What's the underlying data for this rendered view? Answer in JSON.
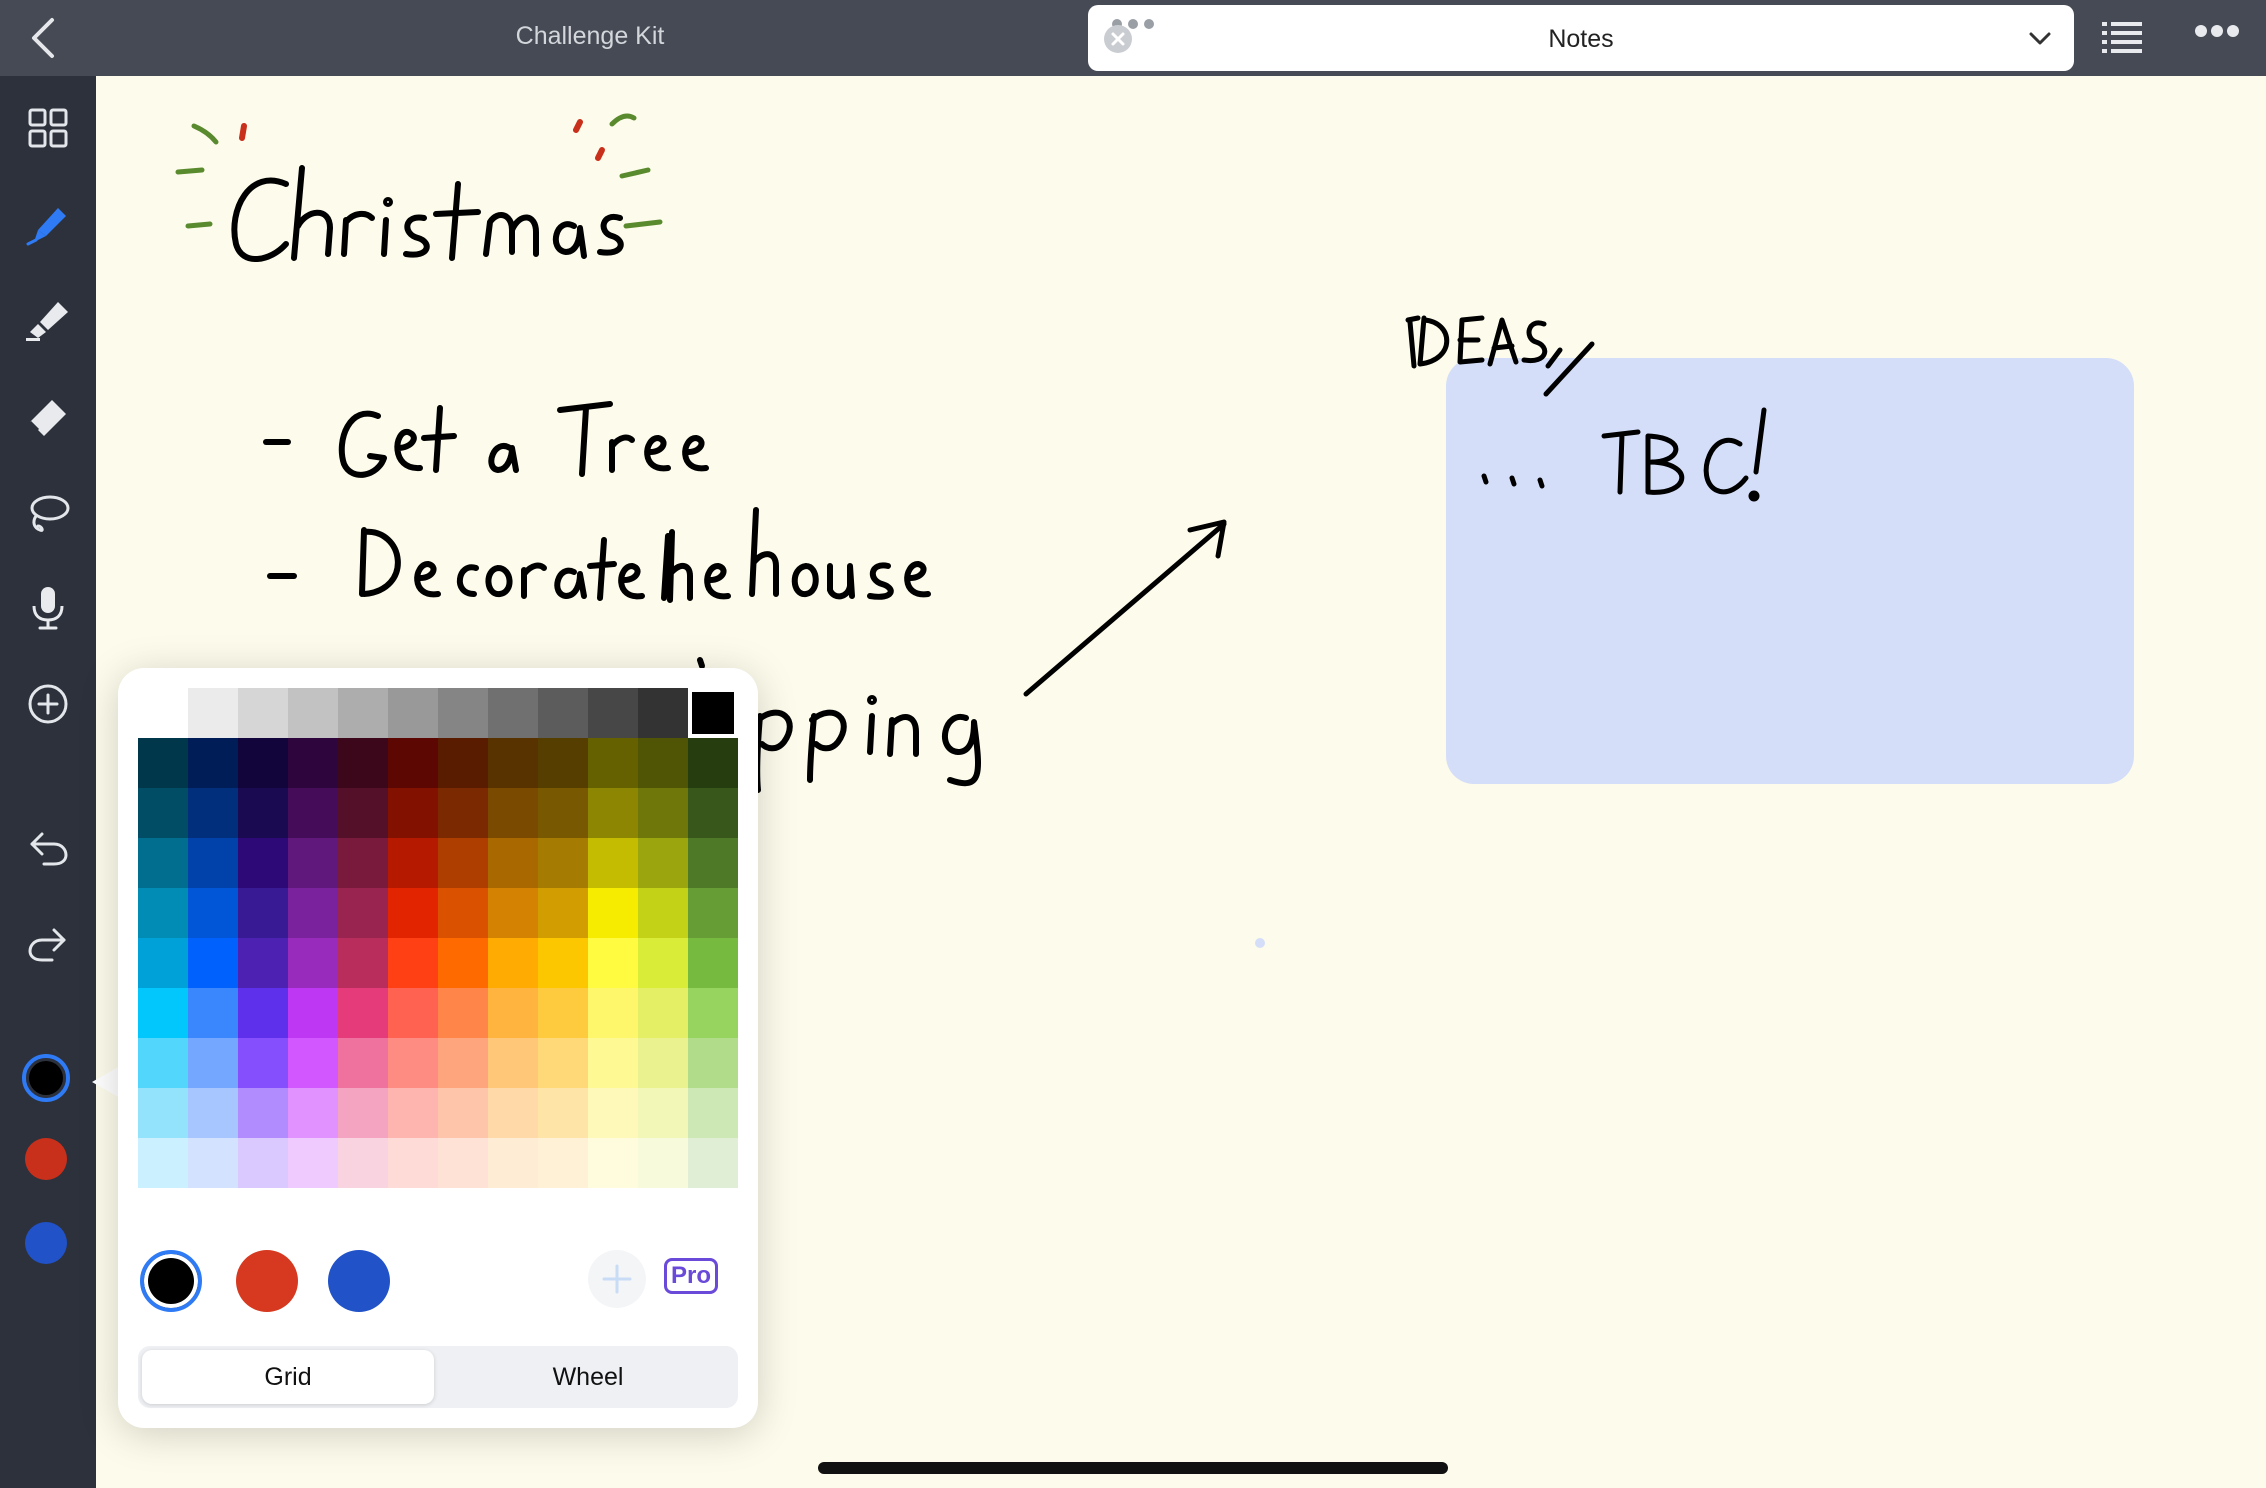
{
  "topbar": {
    "doc_title": "Challenge Kit",
    "notes_label": "Notes",
    "icons": [
      "back-icon",
      "close-icon",
      "chevron-down-icon",
      "list-icon",
      "more-icon"
    ]
  },
  "sidebar": {
    "tools": [
      "grid-icon",
      "pen-icon",
      "highlighter-icon",
      "eraser-icon",
      "lasso-icon",
      "microphone-icon",
      "add-icon",
      "undo-icon",
      "redo-icon"
    ],
    "selected_tool": "pen-icon",
    "swatches": [
      {
        "name": "black",
        "color": "#000000",
        "selected": true
      },
      {
        "name": "red",
        "color": "#c9301c"
      },
      {
        "name": "blue",
        "color": "#2152c8"
      }
    ]
  },
  "canvas": {
    "heading": "Christmas",
    "list": [
      "Get a Tree",
      "Decorate the house",
      "Shopping"
    ],
    "ideas_box": {
      "title": "IDEAS",
      "body": "... TBC!",
      "color": "#d4def8"
    }
  },
  "color_picker": {
    "gray_row": [
      "#ffffff",
      "#ebebeb",
      "#d6d6d6",
      "#c2c2c2",
      "#adadad",
      "#999999",
      "#858585",
      "#707070",
      "#5c5c5c",
      "#474747",
      "#333333",
      "#000000"
    ],
    "selected_color": "#000000",
    "columns": [
      [
        "#00374a",
        "#004d65",
        "#016e8f",
        "#008cb4",
        "#00a1d8",
        "#01c7fc",
        "#52d6fc",
        "#93e3fd",
        "#cbf0ff"
      ],
      [
        "#011d57",
        "#012f7b",
        "#0042a9",
        "#0056d6",
        "#0061fd",
        "#3a87fd",
        "#74a7ff",
        "#a7c6ff",
        "#d3e2ff"
      ],
      [
        "#11053b",
        "#1a0a52",
        "#2c0977",
        "#371a94",
        "#4d22b2",
        "#5e30eb",
        "#864ffe",
        "#b18cfe",
        "#d9c9fe"
      ],
      [
        "#2e063d",
        "#450d59",
        "#61187c",
        "#7a219e",
        "#982abc",
        "#be38f3",
        "#d357fe",
        "#e292fe",
        "#efcaff"
      ],
      [
        "#3c071b",
        "#551029",
        "#791a3d",
        "#99244f",
        "#b92d5d",
        "#e63b7a",
        "#ee719e",
        "#f4a4c0",
        "#f9d3e0"
      ],
      [
        "#5c0701",
        "#831100",
        "#b51a00",
        "#e22400",
        "#ff4015",
        "#ff6250",
        "#ff8c82",
        "#ffb5af",
        "#ffdbd8"
      ],
      [
        "#5a1c00",
        "#7b2900",
        "#ad3e00",
        "#da5100",
        "#ff6a00",
        "#ff8648",
        "#ffa57d",
        "#ffc5ab",
        "#ffe2d6"
      ],
      [
        "#583300",
        "#7a4a00",
        "#a96800",
        "#d38301",
        "#ffab01",
        "#feb43f",
        "#ffc777",
        "#ffd9a8",
        "#ffecd4"
      ],
      [
        "#563d00",
        "#785800",
        "#a67b01",
        "#d19d01",
        "#fdc700",
        "#fecb3e",
        "#ffd977",
        "#ffe4a8",
        "#fff1d5"
      ],
      [
        "#666100",
        "#8d8602",
        "#c4bc00",
        "#f5ec00",
        "#fffb41",
        "#fff76b",
        "#fff994",
        "#fff9b9",
        "#fffcdd"
      ],
      [
        "#4f5504",
        "#6f760a",
        "#9ba50e",
        "#c3d117",
        "#d9ec37",
        "#e4ef65",
        "#eaf28f",
        "#f2f7b7",
        "#f8fadc"
      ],
      [
        "#263e0f",
        "#38571a",
        "#4e7a27",
        "#669d34",
        "#76bb40",
        "#96d35f",
        "#b1dd8b",
        "#cde8b5",
        "#dfeed4"
      ]
    ],
    "recent_colors": [
      "#000000",
      "#d6391f",
      "#2152c8"
    ],
    "pro_label": "Pro",
    "tabs": [
      {
        "label": "Grid",
        "active": true
      },
      {
        "label": "Wheel",
        "active": false
      }
    ]
  }
}
